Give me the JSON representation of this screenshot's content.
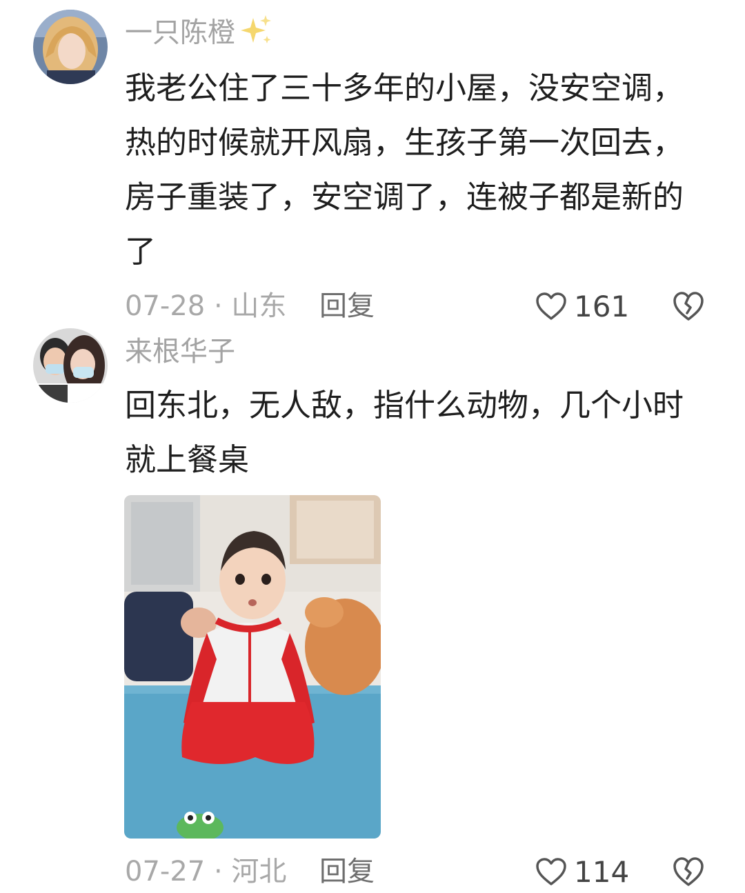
{
  "comments": [
    {
      "username": "一只陈橙",
      "username_emoji": "sparkles-icon",
      "text": "我老公住了三十多年的小屋，没安空调，热的时候就开风扇，生孩子第一次回去，房子重装了，安空调了，连被子都是新的了",
      "date": "07-28",
      "separator": "·",
      "location": "山东",
      "reply_label": "回复",
      "like_count": "161"
    },
    {
      "username": "来根华子",
      "text": "回东北，无人敌，指什么动物，几个小时就上餐桌",
      "date": "07-27",
      "separator": "·",
      "location": "河北",
      "reply_label": "回复",
      "like_count": "114"
    }
  ],
  "icons": {
    "like": "heart-outline-icon",
    "dislike": "broken-heart-icon"
  },
  "colors": {
    "text": "#1e1e1e",
    "muted": "#a3a3a3",
    "reply": "#6e6e6e",
    "sparkle": "#f5d76e"
  }
}
